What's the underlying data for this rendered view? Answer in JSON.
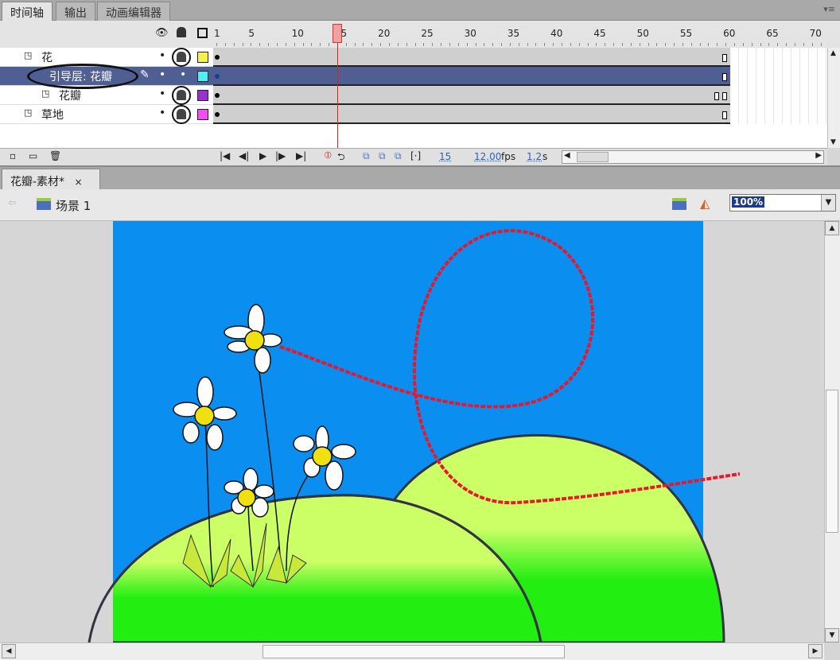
{
  "panel_tabs": [
    "时间轴",
    "输出",
    "动画编辑器"
  ],
  "frame_ticks": [
    "1",
    "5",
    "10",
    "15",
    "20",
    "25",
    "30",
    "35",
    "40",
    "45",
    "50",
    "55",
    "60",
    "65",
    "70"
  ],
  "layers": [
    {
      "name": "花",
      "color": "#f7f24a",
      "locked": true,
      "selected": false,
      "indent": 0
    },
    {
      "name": "引导层: 花瓣",
      "color": "#4ef0f5",
      "locked": false,
      "selected": true,
      "indent": 1
    },
    {
      "name": "花瓣",
      "color": "#9b2fd0",
      "locked": true,
      "selected": false,
      "indent": 2
    },
    {
      "name": "草地",
      "color": "#f54ef0",
      "locked": true,
      "selected": false,
      "indent": 0
    }
  ],
  "playhead_frame": 15,
  "status": {
    "current_frame": "15",
    "fps": "12.00",
    "fps_unit": "fps",
    "time": "1.2",
    "time_unit": "s"
  },
  "document_tab": "花瓣-素材*",
  "close_label": "×",
  "scene": "场景 1",
  "zoom": "100%",
  "colors": {
    "sky": "#0a8ff0",
    "hill": "#ccff66",
    "grass": "#22ee11",
    "path": "#e8182a",
    "selected_layer": "#4f5f94"
  }
}
